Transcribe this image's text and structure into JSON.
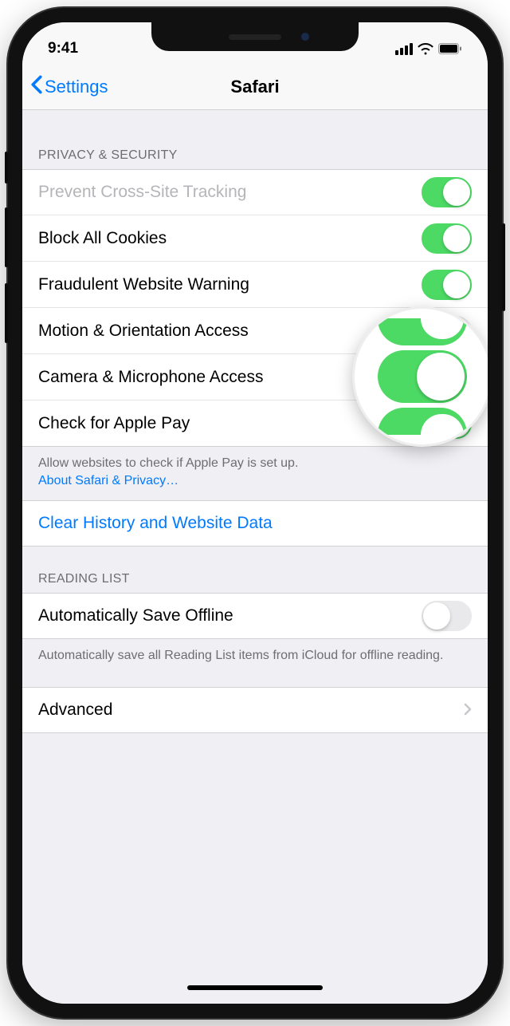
{
  "status": {
    "time": "9:41"
  },
  "nav": {
    "back_label": "Settings",
    "title": "Safari"
  },
  "sections": {
    "privacy": {
      "header": "PRIVACY & SECURITY",
      "rows": {
        "prevent_tracking": {
          "label": "Prevent Cross-Site Tracking",
          "on": true
        },
        "block_cookies": {
          "label": "Block All Cookies",
          "on": true
        },
        "fraud_warning": {
          "label": "Fraudulent Website Warning",
          "on": true
        },
        "motion_access": {
          "label": "Motion & Orientation Access",
          "on": false
        },
        "camera_mic": {
          "label": "Camera & Microphone Access",
          "on": true
        },
        "apple_pay": {
          "label": "Check for Apple Pay",
          "on": true
        }
      },
      "footer_text": "Allow websites to check if Apple Pay is set up.",
      "footer_link": "About Safari & Privacy…"
    },
    "clear": {
      "label": "Clear History and Website Data"
    },
    "reading_list": {
      "header": "READING LIST",
      "row": {
        "label": "Automatically Save Offline",
        "on": false
      },
      "footer_text": "Automatically save all Reading List items from iCloud for offline reading."
    },
    "advanced": {
      "label": "Advanced"
    }
  }
}
